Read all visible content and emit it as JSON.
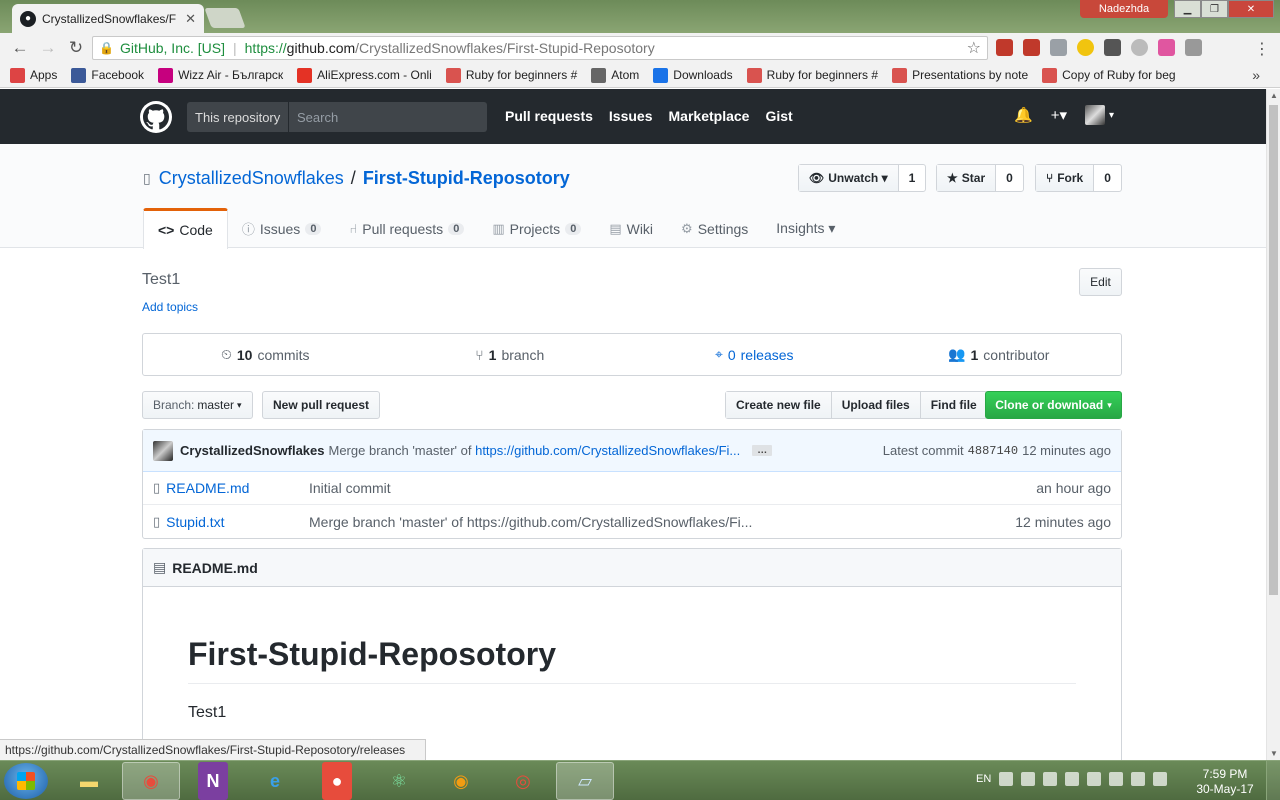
{
  "browser": {
    "tab_title": "CrystallizedSnowflakes/F",
    "tab_close": "✕",
    "user_name": "Nadezhda",
    "security_label": "GitHub, Inc. [US]",
    "url_protocol": "https://",
    "url_host": "github.com",
    "url_path": "/CrystallizedSnowflakes/First-Stupid-Reposotory",
    "bookmarks": [
      {
        "label": "Apps",
        "icon": "apps-grid-icon",
        "color": "#d44"
      },
      {
        "label": "Facebook",
        "icon": "facebook-icon",
        "color": "#3b5998"
      },
      {
        "label": "Wizz Air - Българск",
        "icon": "wizzair-icon",
        "color": "#c6007e"
      },
      {
        "label": "AliExpress.com - Onli",
        "icon": "aliexpress-icon",
        "color": "#e43225"
      },
      {
        "label": "Ruby for beginners #",
        "icon": "slides-icon",
        "color": "#d9534f"
      },
      {
        "label": "Atom",
        "icon": "atom-icon",
        "color": "#666"
      },
      {
        "label": "Downloads",
        "icon": "google-drive-icon",
        "color": "#1a73e8"
      },
      {
        "label": "Ruby for beginners #",
        "icon": "slides-icon",
        "color": "#d9534f"
      },
      {
        "label": "Presentations by note",
        "icon": "slides-icon",
        "color": "#d9534f"
      },
      {
        "label": "Copy of Ruby for beg",
        "icon": "slides-icon",
        "color": "#d9534f"
      }
    ],
    "bookmarks_more": "»",
    "status_url": "https://github.com/CrystallizedSnowflakes/First-Stupid-Reposotory/releases"
  },
  "github": {
    "scope": "This repository",
    "search_placeholder": "Search",
    "nav": [
      "Pull requests",
      "Issues",
      "Marketplace",
      "Gist"
    ],
    "plus": "+▾"
  },
  "repo": {
    "owner": "CrystallizedSnowflakes",
    "separator": "/",
    "name": "First-Stupid-Reposotory",
    "unwatch_label": "Unwatch ▾",
    "watch_count": "1",
    "star_label": "Star",
    "star_count": "0",
    "fork_label": "Fork",
    "fork_count": "0",
    "tabs": [
      {
        "label": "Code",
        "icon": "code-icon",
        "count": null
      },
      {
        "label": "Issues",
        "icon": "issue-icon",
        "count": "0"
      },
      {
        "label": "Pull requests",
        "icon": "pull-request-icon",
        "count": "0"
      },
      {
        "label": "Projects",
        "icon": "project-icon",
        "count": "0"
      },
      {
        "label": "Wiki",
        "icon": "book-icon",
        "count": null
      },
      {
        "label": "Settings",
        "icon": "gear-icon",
        "count": null
      },
      {
        "label": "Insights ▾",
        "icon": null,
        "count": null
      }
    ],
    "description": "Test1",
    "add_topics": "Add topics",
    "edit_label": "Edit",
    "summary": {
      "commits_num": "10",
      "commits_label": "commits",
      "branch_num": "1",
      "branch_label": "branch",
      "releases_num": "0",
      "releases_label": "releases",
      "contributor_num": "1",
      "contributor_label": "contributor"
    },
    "branch_prefix": "Branch:",
    "branch_name": "master",
    "new_pr_label": "New pull request",
    "file_buttons": [
      "Create new file",
      "Upload files",
      "Find file"
    ],
    "clone_label": "Clone or download",
    "commit": {
      "author": "CrystallizedSnowflakes",
      "message": "Merge branch 'master' of",
      "message_link": "https://github.com/CrystallizedSnowflakes/Fi...",
      "ellipsis": "…",
      "latest_label": "Latest commit",
      "sha": "4887140",
      "age": "12 minutes ago"
    },
    "files": [
      {
        "name": "README.md",
        "message": "Initial commit",
        "age": "an hour ago"
      },
      {
        "name": "Stupid.txt",
        "message": "Merge branch 'master' of https://github.com/CrystallizedSnowflakes/Fi...",
        "age": "12 minutes ago"
      }
    ],
    "readme": {
      "file_label": "README.md",
      "heading": "First-Stupid-Reposotory",
      "body": "Test1"
    }
  },
  "taskbar": {
    "language": "EN",
    "time": "7:59 PM",
    "date": "30-May-17"
  }
}
